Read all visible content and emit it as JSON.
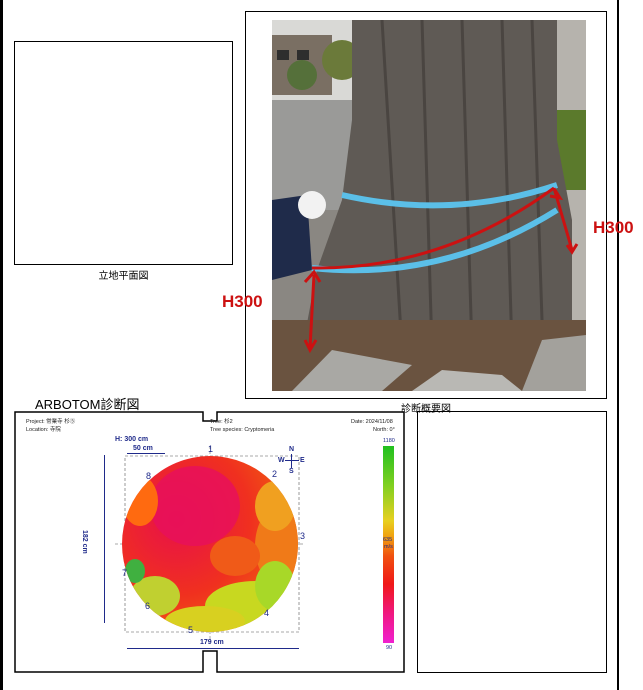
{
  "site_plan": {
    "caption": "立地平面図"
  },
  "overview": {
    "caption": "診断概要図",
    "height_label_right": "H300",
    "height_label_left": "H300"
  },
  "arbotom": {
    "heading": "ARBOTOM診断図",
    "project": "Project: 常業寺 杉⑤",
    "location": "Location: 寺院",
    "tree": "Tree: 杉2",
    "species": "Tree species: Cryptomeria",
    "date": "Date: 2024/11/08",
    "north": "North: 0°",
    "height": "H: 300 cm",
    "scale": "50 cm",
    "width_dim": "179 cm",
    "depth_dim": "182 cm",
    "compass": {
      "n": "N",
      "s": "S",
      "e": "E",
      "w": "W"
    },
    "legend": {
      "max": "1180",
      "mid": "635",
      "unit": "m/s",
      "min": "90"
    },
    "sensors": [
      "1",
      "2",
      "3",
      "4",
      "5",
      "6",
      "7",
      "8"
    ]
  },
  "colors": {
    "red": "#cc1111",
    "navy": "#1f2a8a"
  }
}
